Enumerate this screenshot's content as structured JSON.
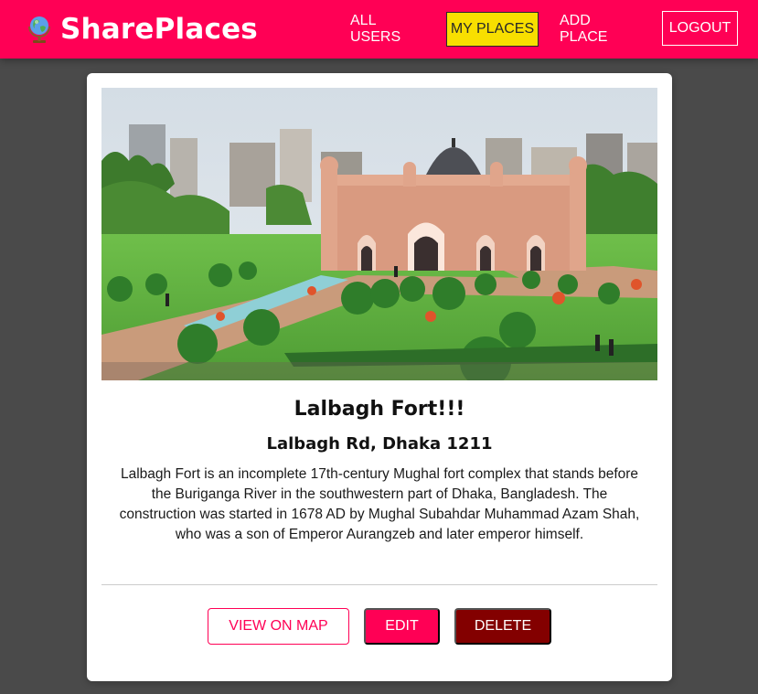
{
  "header": {
    "brand_title": "SharePlaces",
    "nav": {
      "all_users": "ALL USERS",
      "my_places": "MY PLACES",
      "add_place": "ADD PLACE",
      "logout": "LOGOUT"
    }
  },
  "place": {
    "title": "Lalbagh Fort!!!",
    "address": "Lalbagh Rd, Dhaka 1211",
    "description": "Lalbagh Fort is an incomplete 17th-century Mughal fort complex that stands before the Buriganga River in the southwestern part of Dhaka, Bangladesh. The construction was started in 1678 AD by Mughal Subahdar Muhammad Azam Shah, who was a son of Emperor Aurangzeb and later emperor himself."
  },
  "actions": {
    "view_on_map": "VIEW ON MAP",
    "edit": "EDIT",
    "delete": "DELETE"
  },
  "colors": {
    "brand": "#ff0055",
    "active_nav": "#f8df00",
    "delete": "#830000",
    "background": "#4a4a4a"
  }
}
